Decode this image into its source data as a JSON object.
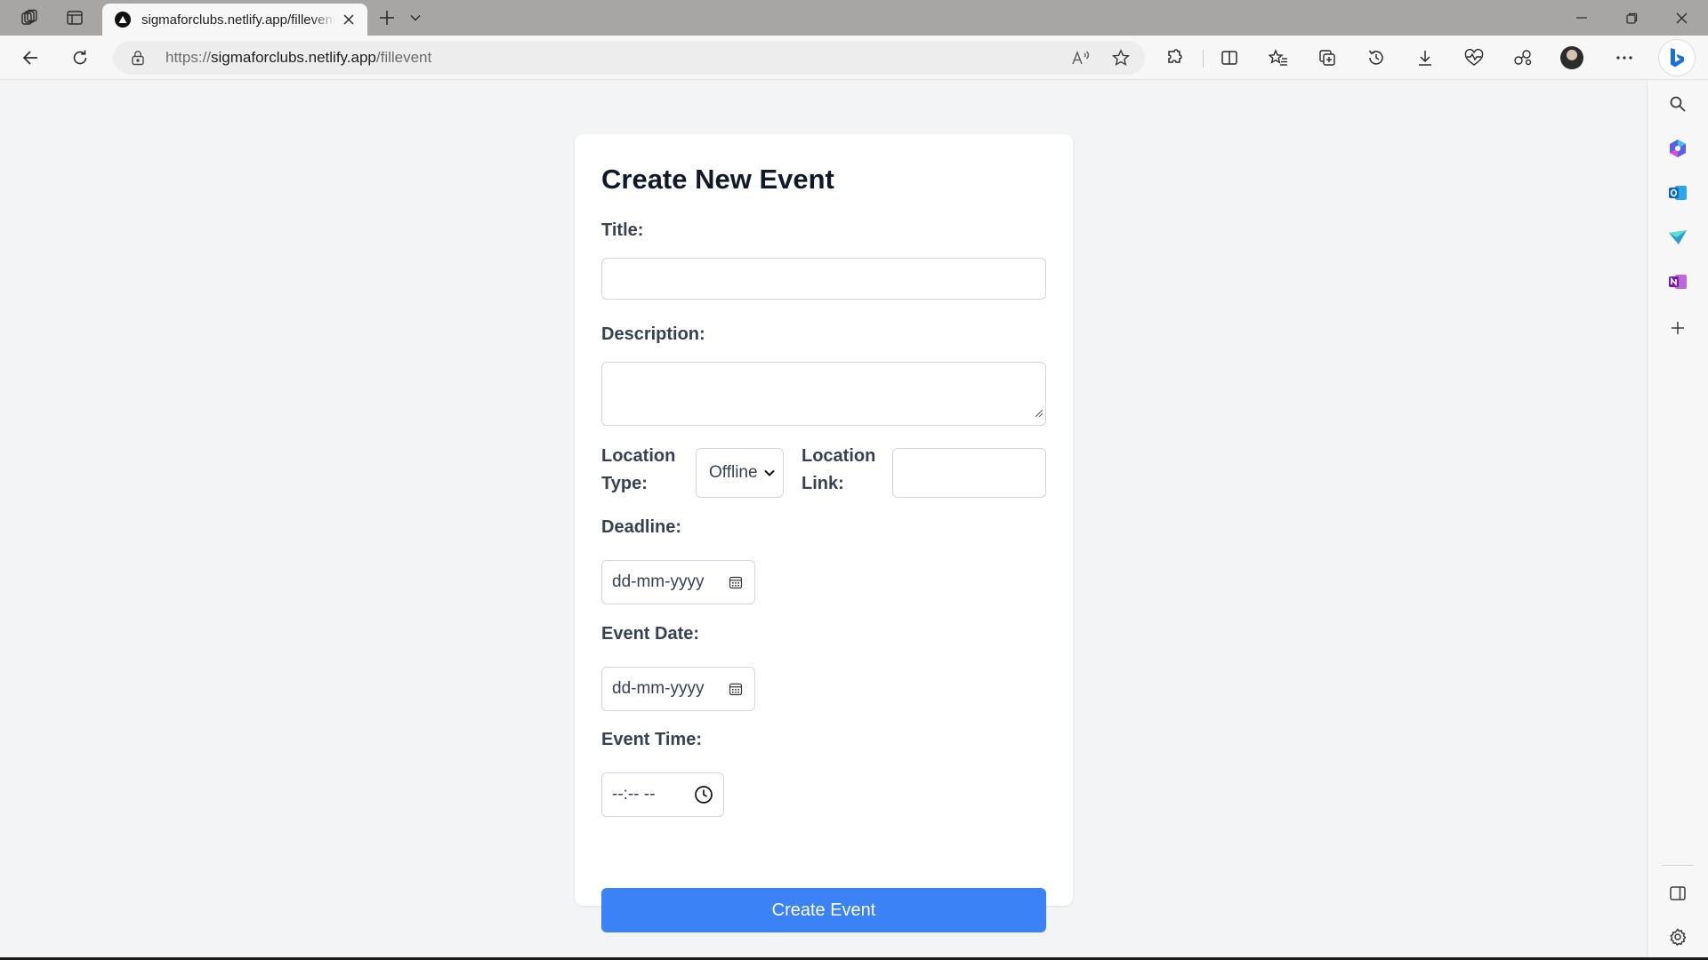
{
  "browser": {
    "tab_title": "sigmaforclubs.netlify.app/fillevent",
    "url_scheme": "https://",
    "url_host": "sigmaforclubs.netlify.app",
    "url_path": "/fillevent"
  },
  "toolbar_icons": [
    "read-aloud-icon",
    "favorite-star-icon",
    "extensions-icon",
    "split-screen-icon",
    "favorites-icon",
    "collections-icon",
    "history-icon",
    "downloads-icon",
    "browser-essentials-icon",
    "performance-icon",
    "profile-icon",
    "more-icon",
    "copilot-icon"
  ],
  "sidebar_icons": [
    "search-icon",
    "copilot-app-icon",
    "outlook-icon",
    "drop-icon",
    "onenote-icon",
    "add-icon",
    "hide-sidebar-icon",
    "settings-icon"
  ],
  "form": {
    "title": "Create New Event",
    "title_label": "Title:",
    "title_value": "",
    "description_label": "Description:",
    "description_value": "",
    "location_type_label_line1": "Location",
    "location_type_label_line2": "Type:",
    "location_type_value": "Offline",
    "location_link_label_line1": "Location",
    "location_link_label_line2": "Link:",
    "location_link_value": "",
    "deadline_label": "Deadline:",
    "deadline_placeholder": "dd-mm-yyyy",
    "event_date_label": "Event Date:",
    "event_date_placeholder": "dd-mm-yyyy",
    "event_time_label": "Event Time:",
    "event_time_placeholder": "--:-- --",
    "submit_label": "Create Event"
  },
  "colors": {
    "accent": "#3b82f6",
    "page_background": "#f3f4f6",
    "card_background": "#ffffff",
    "label_text": "#374151",
    "heading_text": "#111827"
  }
}
